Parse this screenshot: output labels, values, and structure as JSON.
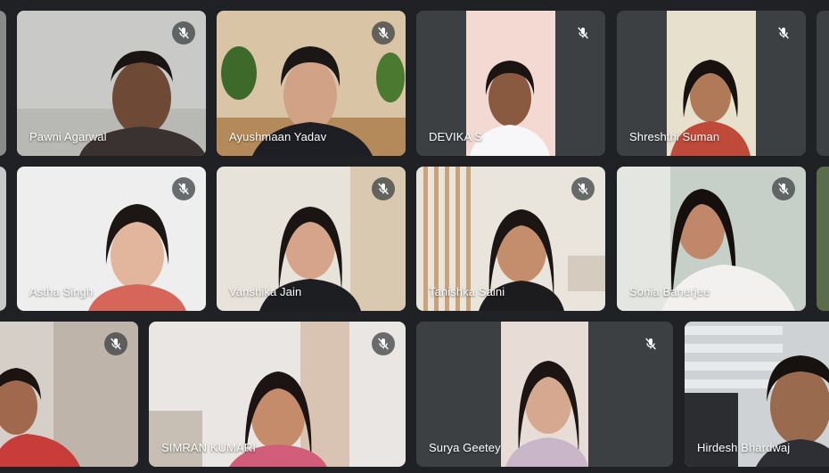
{
  "participants": [
    {
      "name": "Pawni Agarwal",
      "mic_muted": true
    },
    {
      "name": "Ayushmaan Yadav",
      "mic_muted": true
    },
    {
      "name": "DEVIKA S",
      "mic_muted": true
    },
    {
      "name": "Shreshthi Suman",
      "mic_muted": true
    },
    {
      "name": "Astha Singh",
      "mic_muted": true
    },
    {
      "name": "Vanshika Jain",
      "mic_muted": true
    },
    {
      "name": "Tanishka Saini",
      "mic_muted": true
    },
    {
      "name": "Sonia Banerjee",
      "mic_muted": true
    },
    {
      "name": "",
      "mic_muted": true
    },
    {
      "name": "SIMRAN KUMARI",
      "mic_muted": true
    },
    {
      "name": "Surya Geetey",
      "mic_muted": true
    },
    {
      "name": "Hirdesh Bhardwaj",
      "mic_muted": false
    }
  ],
  "icons": {
    "mic_off": "mic-off-icon"
  },
  "colors": {
    "background": "#202124",
    "tile": "#3c4043",
    "name_text": "#ffffff"
  }
}
